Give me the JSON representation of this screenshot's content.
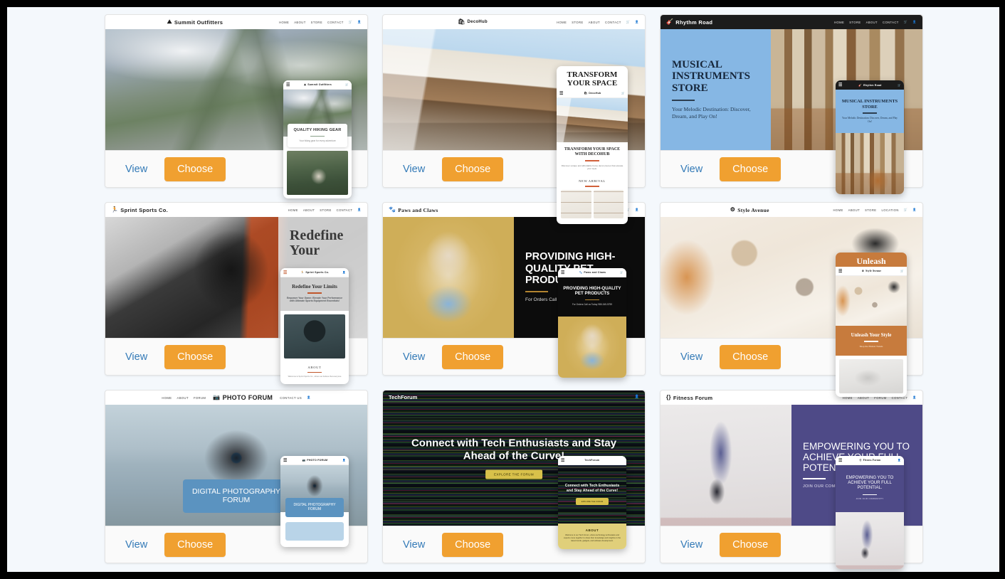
{
  "theme": {
    "page_bg": "#f4f8fc",
    "accent_orange": "#f0a030",
    "link_blue": "#337ab7"
  },
  "actions": {
    "view_label": "View",
    "choose_label": "Choose"
  },
  "nav_default": [
    "HOME",
    "ABOUT",
    "STORE",
    "CONTACT"
  ],
  "templates": [
    {
      "id": "summit-outfitters",
      "brand": "Summit Outfitters",
      "brand_glyph": "⛰",
      "topbar_theme": "light",
      "topbar_layout": "center",
      "nav": [
        "HOME",
        "ABOUT",
        "STORE",
        "CONTACT"
      ],
      "has_cart": true,
      "has_user": true,
      "hero_headline": "",
      "hero_sub": "",
      "mobile": {
        "headline": "QUALITY HIKING GEAR",
        "sub": "Your hiking gear for every adventure"
      }
    },
    {
      "id": "decohub",
      "brand": "DecoHub",
      "brand_glyph": "🛋",
      "topbar_theme": "light",
      "topbar_layout": "center",
      "nav": [
        "HOME",
        "STORE",
        "ABOUT",
        "CONTACT"
      ],
      "has_cart": true,
      "has_user": true,
      "hero_headline": "",
      "hero_sub": "",
      "mobile": {
        "big_headline": "TRANSFORM YOUR SPACE",
        "headline": "TRANSFORM YOUR SPACE WITH DECOHUB",
        "sub": "Discover unique and affordable home decor pieces that elevate your style.",
        "section_title": "NEW ARRIVAL"
      }
    },
    {
      "id": "rhythm-road",
      "brand": "Rhythm Road",
      "brand_glyph": "🎸",
      "topbar_theme": "dark",
      "topbar_layout": "between",
      "nav": [
        "HOME",
        "STORE",
        "ABOUT",
        "CONTACT"
      ],
      "has_cart": true,
      "has_user": true,
      "hero_headline": "MUSICAL INSTRUMENTS STORE",
      "hero_sub": "Your Melodic Destination: Discover, Dream, and Play On!",
      "mobile": {
        "headline": "MUSICAL INSTRUMENTS STORE",
        "sub": "Your Melodic Destination: Discover, Dream, and Play On!"
      }
    },
    {
      "id": "sprint-sports",
      "brand": "Sprint Sports Co.",
      "brand_glyph": "🏃",
      "topbar_theme": "light",
      "topbar_layout": "between",
      "nav": [
        "HOME",
        "ABOUT",
        "STORE",
        "CONTACT"
      ],
      "has_cart": false,
      "has_user": true,
      "hero_headline": "Redefine Your",
      "hero_sub": "",
      "mobile": {
        "headline": "Redefine Your Limits",
        "sub": "Empower Your Game: Elevate Your Performance with Ultimate Sports Equipment Essentials!",
        "section_title": "ABOUT",
        "section_text": "Welcome to Sprint Sports Co., where we believe that everyone"
      }
    },
    {
      "id": "paws-and-claws",
      "brand": "Paws and Claws",
      "brand_glyph": "🐾",
      "topbar_theme": "light",
      "topbar_layout": "between",
      "nav": [
        "HOME",
        "STORE",
        "ABOUT",
        "CONTACT"
      ],
      "has_cart": true,
      "has_user": true,
      "hero_headline": "PROVIDING HIGH-QUALITY PET PRODUCTS",
      "hero_sub": "For Orders Call us Today 985-345-5759",
      "mobile": {
        "headline": "PROVIDING HIGH-QUALITY PET PRODUCTS",
        "sub": "For Orders Call us Today 985-345-5759"
      }
    },
    {
      "id": "style-avenue",
      "brand": "Style Avenue",
      "brand_glyph": "⚙",
      "topbar_theme": "light",
      "topbar_layout": "center",
      "nav": [
        "HOME",
        "ABOUT",
        "STORE",
        "LOCATION"
      ],
      "has_cart": true,
      "has_user": true,
      "hero_headline": "Unleash",
      "hero_sub": "",
      "mobile": {
        "headline": "Unleash Your Style",
        "sub": "Shop the Hottest Trends"
      }
    },
    {
      "id": "photo-forum",
      "brand": "PHOTO FORUM",
      "brand_glyph": "📷",
      "topbar_theme": "light",
      "topbar_layout": "center",
      "nav": [
        "HOME",
        "ABOUT",
        "FORUM",
        "CONTACT US"
      ],
      "has_cart": false,
      "has_user": true,
      "hero_headline": "DIGITAL PHOTOGRAPHY FORUM",
      "hero_sub": "",
      "mobile": {
        "headline": "DIGITAL PHOTOGRAPHY FORUM",
        "sub": ""
      }
    },
    {
      "id": "techforum",
      "brand": "TechForum",
      "brand_glyph": "",
      "topbar_theme": "dark",
      "topbar_layout": "between",
      "nav": [],
      "has_cart": false,
      "has_user": true,
      "hero_headline": "Connect with Tech Enthusiasts and Stay Ahead of the Curve!",
      "hero_sub": "",
      "hero_button": "EXPLORE THE FORUM",
      "mobile": {
        "headline": "Connect with Tech Enthusiasts and Stay Ahead of the Curve!",
        "button": "EXPLORE THE FORUM",
        "section_title": "ABOUT",
        "section_text": "Welcome to our Tech Forum, where technology enthusiasts and experts come together to share their knowledge and insights on the latest trends, gadgets, and software development."
      }
    },
    {
      "id": "fitness-forum",
      "brand": "Fitness Forum",
      "brand_glyph": "{}",
      "topbar_theme": "light",
      "topbar_layout": "between",
      "nav": [
        "HOME",
        "ABOUT",
        "FORUM",
        "CONTACT"
      ],
      "has_cart": false,
      "has_user": true,
      "hero_headline": "EMPOWERING YOU TO ACHIEVE YOUR FULL POTENTIAL.",
      "hero_sub": "JOIN OUR COMMUNITY",
      "mobile": {
        "headline": "EMPOWERING YOU TO ACHIEVE YOUR FULL POTENTIAL.",
        "sub": "JOIN OUR COMMUNITY"
      }
    }
  ],
  "icons": {
    "cart": "🛒",
    "user": "👤",
    "burger": "☰"
  }
}
